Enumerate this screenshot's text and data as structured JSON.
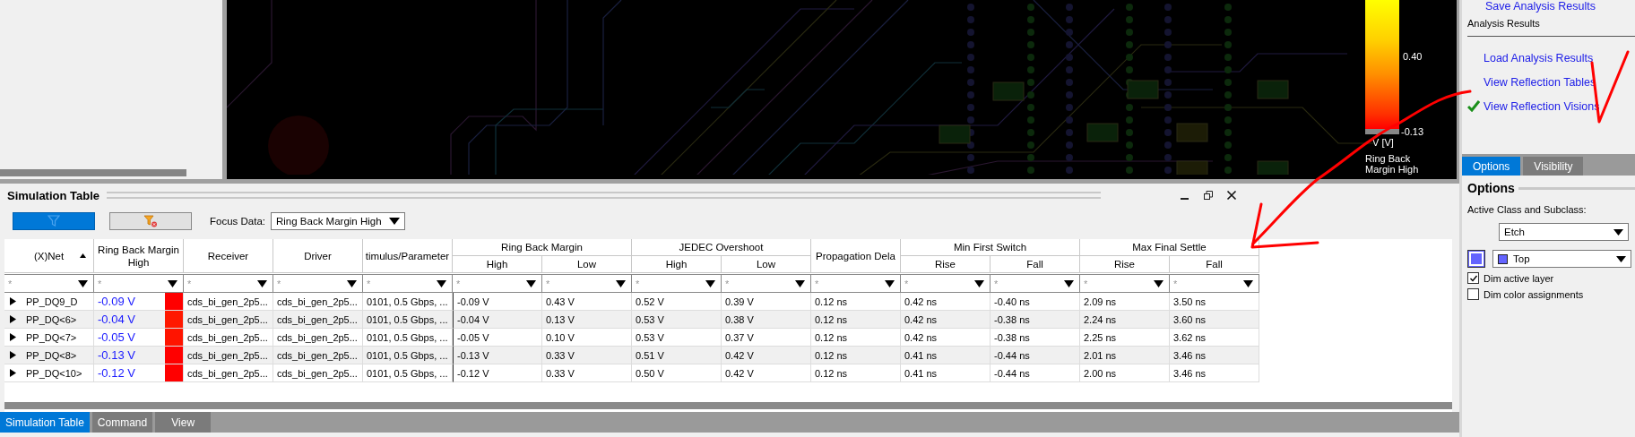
{
  "legend": {
    "max_label": "0.40",
    "min_label": "-0.13",
    "unit": "V [V]",
    "title": "Ring Back Margin High"
  },
  "right_panel": {
    "cut_link": "Save Analysis Results",
    "section": "Analysis Results",
    "links": [
      {
        "label": "Load Analysis Results",
        "checked": false
      },
      {
        "label": "View Reflection Tables",
        "checked": false
      },
      {
        "label": "View Reflection Visions",
        "checked": true
      }
    ],
    "tabs": [
      {
        "label": "Options",
        "selected": true
      },
      {
        "label": "Visibility",
        "selected": false
      }
    ],
    "options": {
      "title": "Options",
      "class_label": "Active Class and Subclass:",
      "class_value": "Etch",
      "subclass": {
        "color": "#6464ff",
        "value": "Top"
      },
      "checkboxes": [
        {
          "label": "Dim active layer",
          "checked": true
        },
        {
          "label": "Dim color assignments",
          "checked": false
        }
      ]
    }
  },
  "simulation_table": {
    "title": "Simulation Table",
    "focus_label": "Focus Data:",
    "focus_value": "Ring Back Margin High",
    "header": [
      {
        "kind": "single",
        "label": "(X)Net",
        "sort_ascending": true
      },
      {
        "kind": "single",
        "label": "Ring Back Margin High"
      },
      {
        "kind": "single",
        "label": "Receiver"
      },
      {
        "kind": "single",
        "label": "Driver"
      },
      {
        "kind": "single",
        "label": "timulus/Parameter"
      },
      {
        "kind": "group",
        "label": "Ring Back Margin",
        "children": [
          "High",
          "Low"
        ]
      },
      {
        "kind": "group",
        "label": "JEDEC Overshoot",
        "children": [
          "High",
          "Low"
        ]
      },
      {
        "kind": "single",
        "label": "Propagation Dela"
      },
      {
        "kind": "group",
        "label": "Min First Switch",
        "children": [
          "Rise",
          "Fall"
        ]
      },
      {
        "kind": "group",
        "label": "Max Final Settle",
        "children": [
          "Rise",
          "Fall"
        ]
      }
    ],
    "filters": [
      "*",
      "*",
      "*",
      "*",
      "*",
      "*",
      "*",
      "*",
      "*",
      "*",
      "*",
      "*",
      "*",
      "*"
    ],
    "rows": [
      {
        "expanded": false,
        "net": "PP_DQ9_D",
        "focus_value": "-0.09 V",
        "color": "#ff0000",
        "cells": [
          "cds_bi_gen_2p5...",
          "cds_bi_gen_2p5...",
          "0101, 0.5 Gbps, ...",
          "-0.09 V",
          "0.43 V",
          "0.52 V",
          "0.39 V",
          "0.12 ns",
          "0.42 ns",
          "-0.40 ns",
          "2.09 ns",
          "3.50 ns"
        ]
      },
      {
        "expanded": false,
        "net": "PP_DQ<6>",
        "focus_value": "-0.04 V",
        "color": "#ff1800",
        "cells": [
          "cds_bi_gen_2p5...",
          "cds_bi_gen_2p5...",
          "0101, 0.5 Gbps, ...",
          "-0.04 V",
          "0.13 V",
          "0.53 V",
          "0.38 V",
          "0.12 ns",
          "0.42 ns",
          "-0.38 ns",
          "2.24 ns",
          "3.60 ns"
        ]
      },
      {
        "expanded": false,
        "net": "PP_DQ<7>",
        "focus_value": "-0.05 V",
        "color": "#ff1400",
        "cells": [
          "cds_bi_gen_2p5...",
          "cds_bi_gen_2p5...",
          "0101, 0.5 Gbps, ...",
          "-0.05 V",
          "0.10 V",
          "0.53 V",
          "0.37 V",
          "0.12 ns",
          "0.42 ns",
          "-0.38 ns",
          "2.25 ns",
          "3.62 ns"
        ]
      },
      {
        "expanded": false,
        "net": "PP_DQ<8>",
        "focus_value": "-0.13 V",
        "color": "#ff0000",
        "cells": [
          "cds_bi_gen_2p5...",
          "cds_bi_gen_2p5...",
          "0101, 0.5 Gbps, ...",
          "-0.13 V",
          "0.33 V",
          "0.51 V",
          "0.42 V",
          "0.12 ns",
          "0.41 ns",
          "-0.44 ns",
          "2.01 ns",
          "3.46 ns"
        ]
      },
      {
        "expanded": false,
        "net": "PP_DQ<10>",
        "focus_value": "-0.12 V",
        "color": "#ff0000",
        "cells": [
          "cds_bi_gen_2p5...",
          "cds_bi_gen_2p5...",
          "0101, 0.5 Gbps, ...",
          "-0.12 V",
          "0.33 V",
          "0.50 V",
          "0.42 V",
          "0.12 ns",
          "0.41 ns",
          "-0.44 ns",
          "2.00 ns",
          "3.46 ns"
        ]
      }
    ]
  },
  "bottom_tabs": [
    {
      "label": "Simulation Table",
      "selected": true
    },
    {
      "label": "Command",
      "selected": false
    },
    {
      "label": "View",
      "selected": false
    }
  ]
}
